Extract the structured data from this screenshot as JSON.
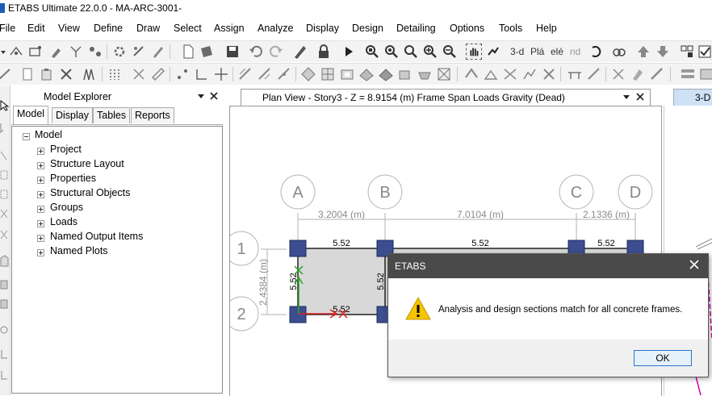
{
  "window": {
    "title": "ETABS Ultimate 22.0.0 - MA-ARC-3001-"
  },
  "menu": {
    "items": [
      "File",
      "Edit",
      "View",
      "Define",
      "Draw",
      "Select",
      "Assign",
      "Analyze",
      "Display",
      "Design",
      "Detailing",
      "Options",
      "Tools",
      "Help"
    ]
  },
  "toolbar": {
    "view_3d": "3-d",
    "plan": "Plá",
    "elevation": "elé",
    "nd": "nd"
  },
  "explorer": {
    "title": "Model Explorer",
    "tabs": [
      "Model",
      "Display",
      "Tables",
      "Reports"
    ],
    "active_tab": "Model",
    "root": "Model",
    "items": [
      "Project",
      "Structure Layout",
      "Properties",
      "Structural Objects",
      "Groups",
      "Loads",
      "Named Output Items",
      "Named Plots"
    ]
  },
  "plan_view": {
    "title": "Plan View - Story3 - Z = 8.9154 (m)  Frame Span Loads Gravity (Dead)",
    "grid_x": [
      "A",
      "B",
      "C",
      "D"
    ],
    "grid_y": [
      "1",
      "2"
    ],
    "dims_x": [
      "3.2004 (m)",
      "7.0104 (m)",
      "2.1336 (m)"
    ],
    "dim_y": "2.4384 (m)",
    "load_values": [
      "5.52",
      "5.52",
      "5.52",
      "5.52",
      "5.52",
      "5.52"
    ]
  },
  "view3d": {
    "title": "3-D"
  },
  "dialog": {
    "title": "ETABS",
    "message": "Analysis and design sections match for all concrete frames.",
    "ok": "OK",
    "icon": "warning-icon"
  },
  "colors": {
    "accent": "#2a73c9",
    "column": "#3c4e8f",
    "dialog_title": "#4a4a4a",
    "warning": "#f5c400"
  }
}
